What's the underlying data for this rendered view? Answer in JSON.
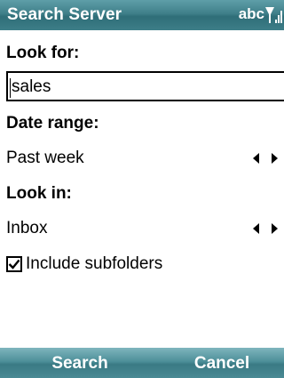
{
  "titlebar": {
    "title": "Search Server",
    "input_mode": "abc",
    "signal_icon": "signal-strength-icon"
  },
  "form": {
    "look_for_label": "Look for:",
    "look_for_value": "sales",
    "date_range_label": "Date range:",
    "date_range_value": "Past week",
    "look_in_label": "Look in:",
    "look_in_value": "Inbox",
    "include_subfolders_label": "Include subfolders",
    "include_subfolders_checked": true
  },
  "softkeys": {
    "left": "Search",
    "right": "Cancel"
  },
  "colors": {
    "titlebar": "#3f7f89",
    "softbar": "#4d8f99",
    "text": "#000000"
  }
}
